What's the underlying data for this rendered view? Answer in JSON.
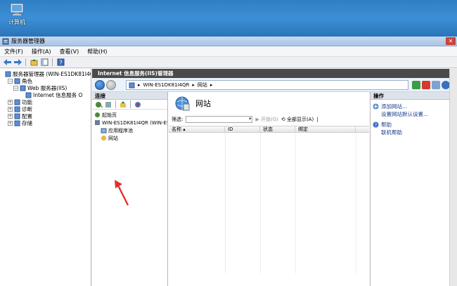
{
  "desktop": {
    "icon_label": "计算机"
  },
  "window": {
    "title": "服务器管理器",
    "close_glyph": "✕"
  },
  "menu": [
    "文件(F)",
    "操作(A)",
    "查看(V)",
    "帮助(H)"
  ],
  "left_tree": [
    {
      "label": "服务器管理器 (WIN-ES1DK81I4Q",
      "exp": "",
      "indent": 0
    },
    {
      "label": "角色",
      "exp": "−",
      "indent": 1
    },
    {
      "label": "Web 服务器(IIS)",
      "exp": "−",
      "indent": 2
    },
    {
      "label": "Internet 信息服务 O",
      "exp": "",
      "indent": 3
    },
    {
      "label": "功能",
      "exp": "+",
      "indent": 1
    },
    {
      "label": "诊断",
      "exp": "+",
      "indent": 1
    },
    {
      "label": "配置",
      "exp": "+",
      "indent": 1
    },
    {
      "label": "存储",
      "exp": "+",
      "indent": 1
    }
  ],
  "iis": {
    "title": "Internet 信息服务(IIS)管理器",
    "address": [
      "WIN-ES1DK81I4QR",
      "网站"
    ],
    "address_sep": "▸"
  },
  "connections": {
    "header": "连接",
    "tree": [
      {
        "label": "起始页",
        "indent": 0
      },
      {
        "label": "WIN-ES1DK81I4QR (WIN-ES",
        "indent": 0
      },
      {
        "label": "应用程序池",
        "indent": 1
      },
      {
        "label": "网站",
        "indent": 1
      }
    ]
  },
  "features": {
    "title": "网站",
    "filter_label": "筛选:",
    "start_btn": "开始(G)",
    "show_all_btn": "全部显示(A)",
    "columns": [
      "名称",
      "ID",
      "状态",
      "绑定"
    ]
  },
  "actions": {
    "header": "操作",
    "items": [
      {
        "label": "添加网站...",
        "icon": "add-site-icon",
        "sub": false
      },
      {
        "label": "设置网站默认设置...",
        "icon": "",
        "sub": true
      },
      {
        "label": "帮助",
        "icon": "help-icon",
        "sub": false
      },
      {
        "label": "联机帮助",
        "icon": "",
        "sub": true
      }
    ]
  },
  "colors": {
    "desktop": "#2f7fc4",
    "titlebar": "#a9c4e6",
    "iis_title": "#4a4a4a",
    "arrow": "#e03030",
    "link": "#1a3e8c"
  }
}
